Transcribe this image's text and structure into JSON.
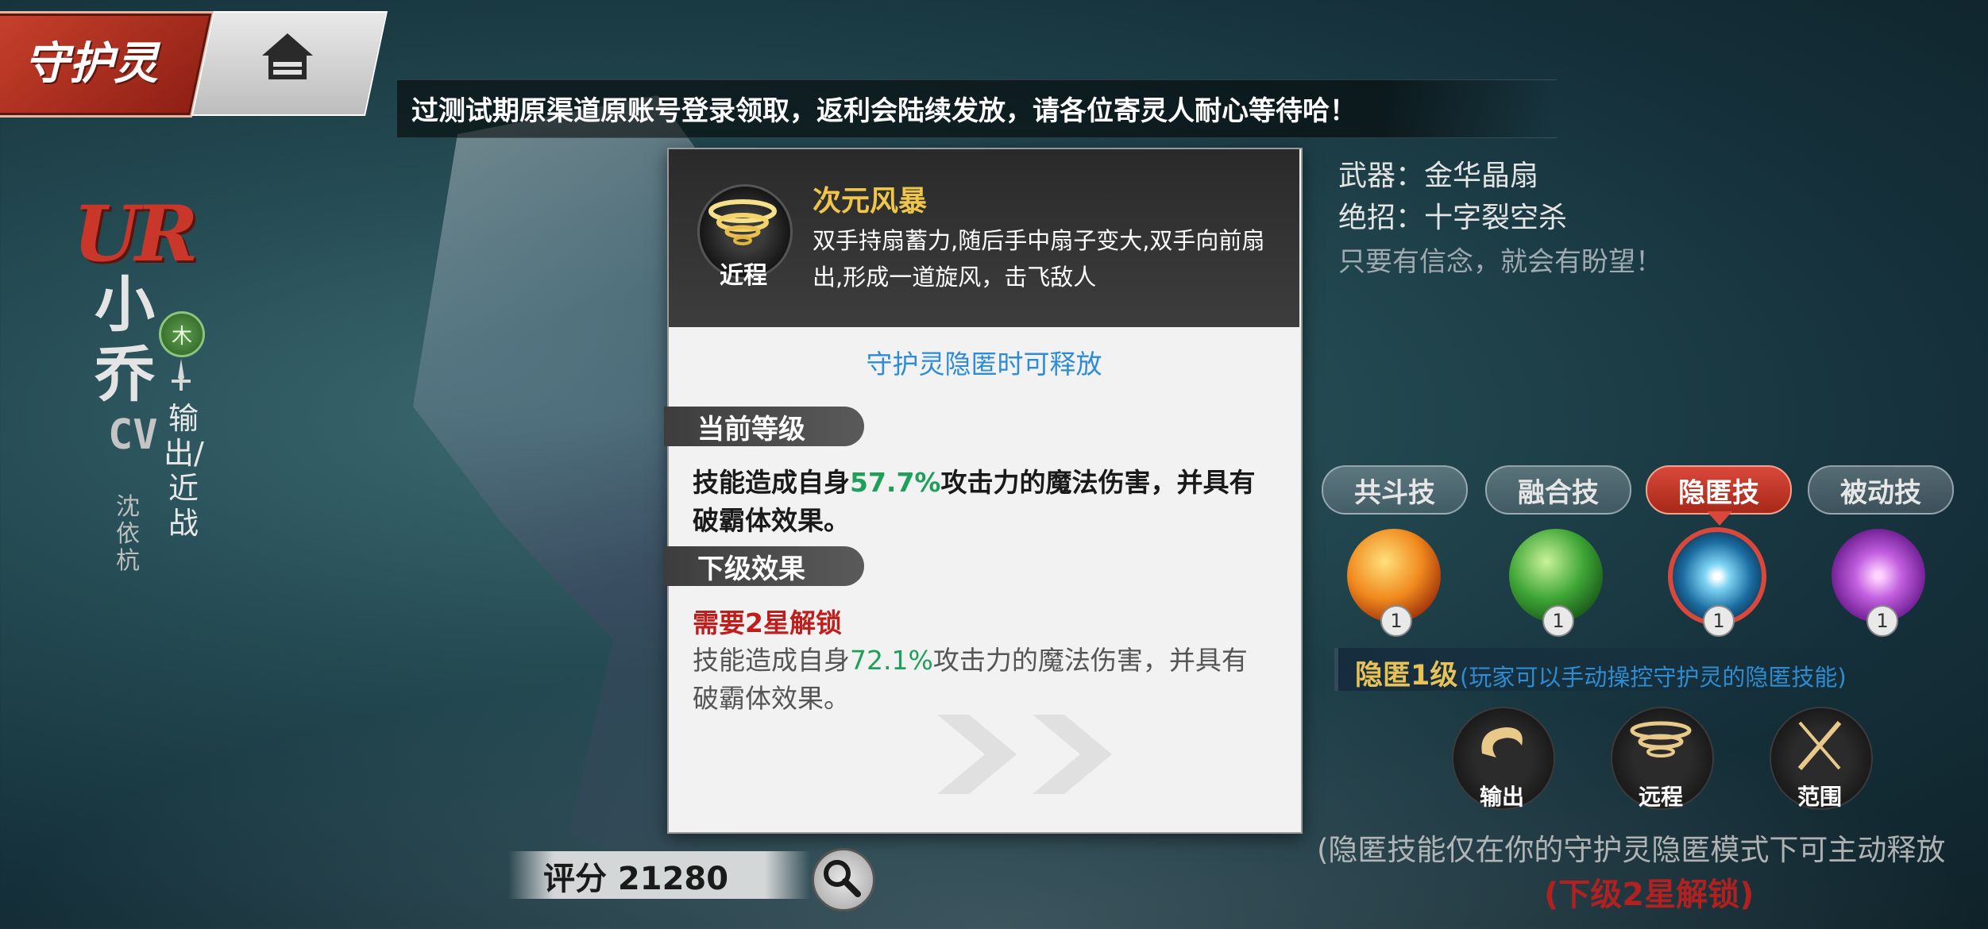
{
  "header": {
    "logo_text": "守护灵",
    "announcement": "过测试期原渠道原账号登录领取，返利会陆续发放，请各位寄灵人耐心等待哈！"
  },
  "character": {
    "rarity": "UR",
    "name": "小乔",
    "element": "木",
    "role": "输出/近战",
    "cv_label": "CV",
    "cv_name": "沈依杭"
  },
  "popup": {
    "range_label": "近程",
    "skill_name": "次元风暴",
    "skill_desc": "双手持扇蓄力,随后手中扇子变大,双手向前扇出,形成一道旋风，击飞敌人",
    "condition": "守护灵隐匿时可释放",
    "current_tag": "当前等级",
    "current_prefix": "技能造成自身",
    "current_pct": "57.7%",
    "current_suffix": "攻击力的魔法伤害，并具有破霸体效果。",
    "next_tag": "下级效果",
    "next_lock": "需要2星解锁",
    "next_prefix": "技能造成自身",
    "next_pct": "72.1%",
    "next_suffix": "攻击力的魔法伤害，并具有破霸体效果。"
  },
  "info": {
    "weapon": "武器：金华晶扇",
    "ultimate": "绝招：十字裂空杀",
    "motto": "只要有信念，就会有盼望！"
  },
  "skill_tabs": [
    {
      "label": "共斗技",
      "level": "1"
    },
    {
      "label": "融合技",
      "level": "1"
    },
    {
      "label": "隐匿技",
      "level": "1"
    },
    {
      "label": "被动技",
      "level": "1"
    }
  ],
  "hidden_skill": {
    "title": "隐匿1级",
    "note": "(玩家可以手动操控守护灵的隐匿技能)"
  },
  "skill_tags": [
    {
      "label": "输出",
      "icon": "swirl-icon"
    },
    {
      "label": "远程",
      "icon": "whirlwind-icon"
    },
    {
      "label": "范围",
      "icon": "cross-blade-icon"
    }
  ],
  "footer": {
    "hint": "(隐匿技能仅在你的守护灵隐匿模式下可主动释放",
    "unlock_hint": "(下级2星解锁)",
    "score": "评分 21280"
  },
  "colors": {
    "accent_red": "#d9483a",
    "highlight_green": "#1fa05a",
    "condition_blue": "#2e8bd6",
    "gold": "#f0c64a"
  }
}
